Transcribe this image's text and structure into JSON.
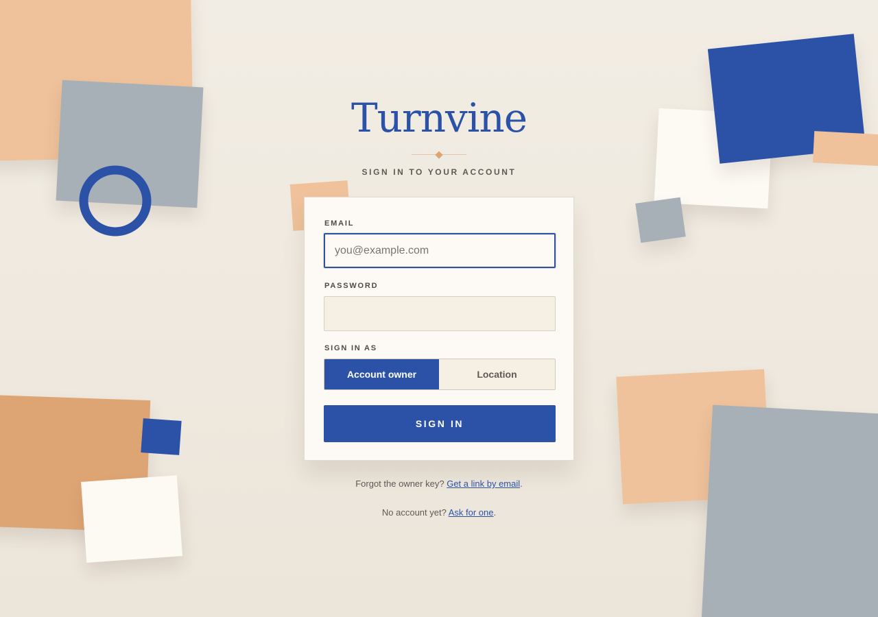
{
  "brand": {
    "name": "Turnvine"
  },
  "subtitle": "SIGN IN TO YOUR ACCOUNT",
  "form": {
    "email_label": "EMAIL",
    "email_placeholder": "you@example.com",
    "email_value": "",
    "password_label": "PASSWORD",
    "password_value": "",
    "role_label": "SIGN IN AS",
    "role_options": [
      "Account owner",
      "Location"
    ],
    "role_selected": "Account owner",
    "submit_label": "SIGN IN"
  },
  "footer": {
    "forgot_text": "Forgot the owner key?",
    "forgot_link": "Get a link by email",
    "forgot_suffix": ".",
    "signup_text": "No account yet?",
    "signup_link": "Ask for one",
    "signup_suffix": "."
  },
  "colors": {
    "accent": "#2c52a8",
    "peach": "#efc29b",
    "slate": "#a7b0b6",
    "terracotta": "#dea574",
    "background": "#efe9e0"
  }
}
